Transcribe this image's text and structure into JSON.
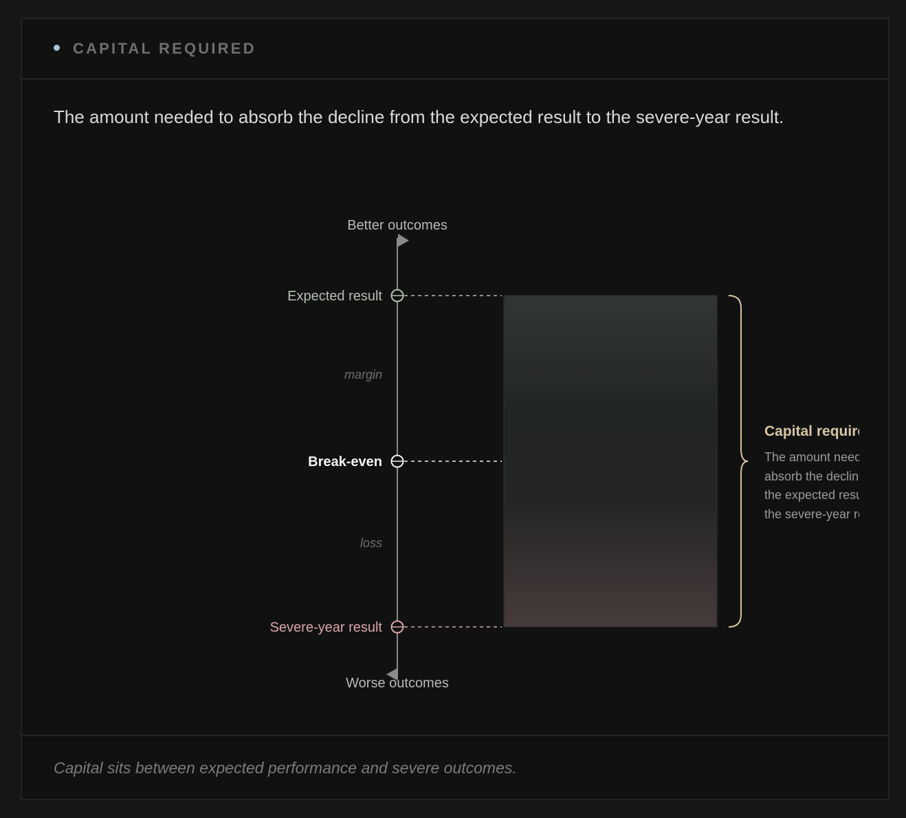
{
  "card": {
    "title": "CAPITAL REQUIRED",
    "description": "The amount needed to absorb the decline from the expected result to the severe-year result.",
    "caption": "Capital sits between expected performance and severe outcomes."
  },
  "colors": {
    "accent_dot": "#a9c6d6",
    "expected": "#b3c0ae",
    "breakeven": "#f2f2f2",
    "severe": "#d9a6ab",
    "axis": "#8a8a8a",
    "bracket": "#d6c6a2"
  },
  "diagram": {
    "axis_top_label": "Better outcomes",
    "axis_bottom_label": "Worse outcomes",
    "levels": {
      "expected": "Expected result",
      "breakeven": "Break-even",
      "severe": "Severe-year result"
    },
    "zones": {
      "margin": "margin",
      "loss": "loss"
    },
    "callout": {
      "title": "Capital required",
      "lines": [
        "The amount needed to",
        "absorb the decline from",
        "the expected result to",
        "the severe-year result."
      ]
    }
  }
}
